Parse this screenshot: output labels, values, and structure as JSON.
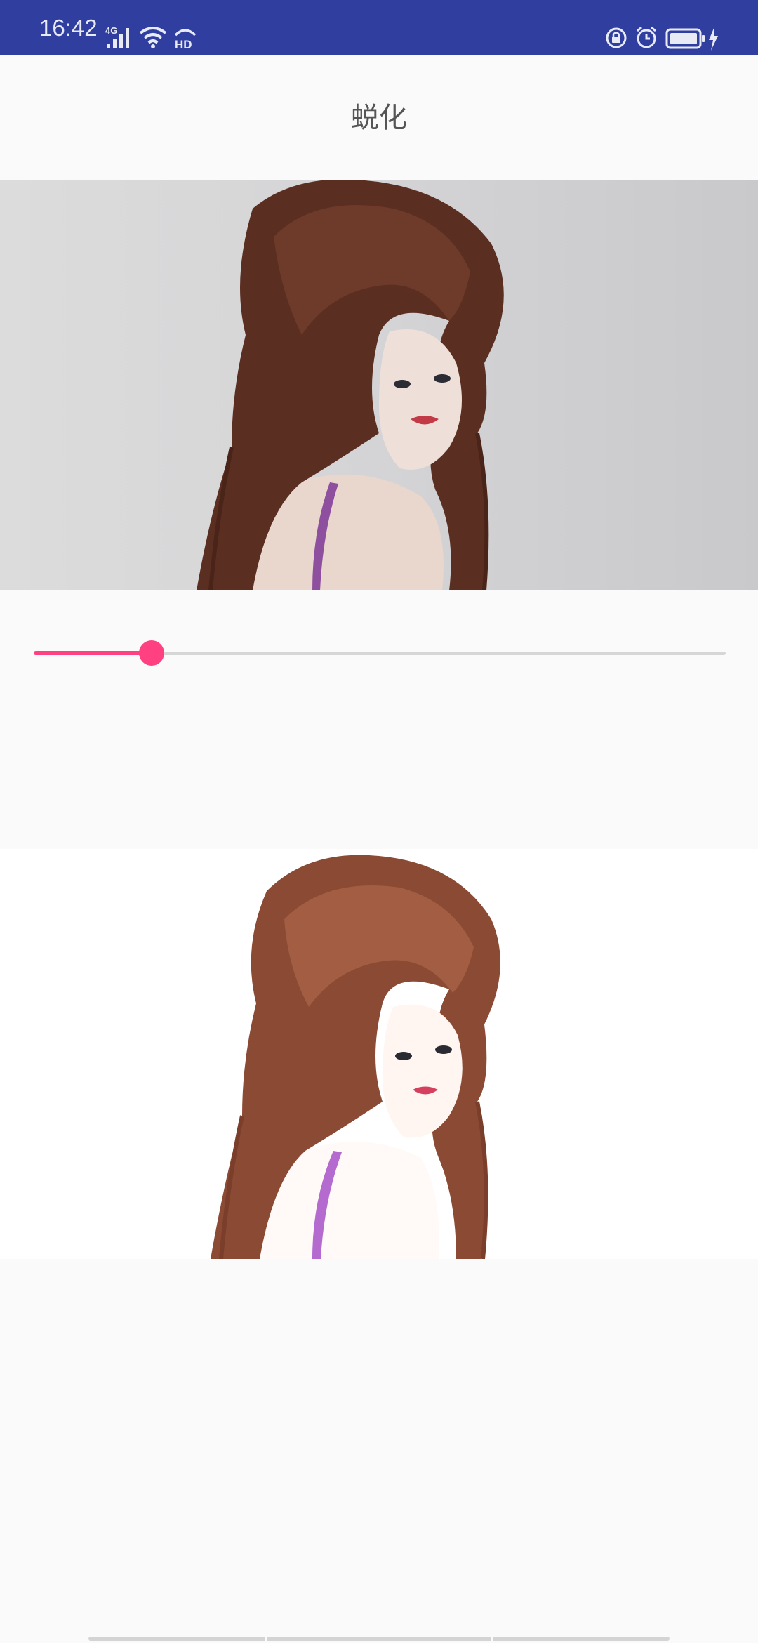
{
  "status_bar": {
    "time": "16:42",
    "network_label": "4G",
    "hd_label": "HD",
    "icons": [
      "signal-icon",
      "wifi-icon",
      "hd-icon",
      "screen-lock-icon",
      "alarm-icon",
      "battery-icon",
      "charging-icon"
    ]
  },
  "title_bar": {
    "title": "蜕化"
  },
  "original_image": {
    "icon": "portrait-photo"
  },
  "slider": {
    "value": 0.17,
    "accent_color": "#ff4081"
  },
  "feathered_image": {
    "icon": "portrait-photo-feathered"
  }
}
